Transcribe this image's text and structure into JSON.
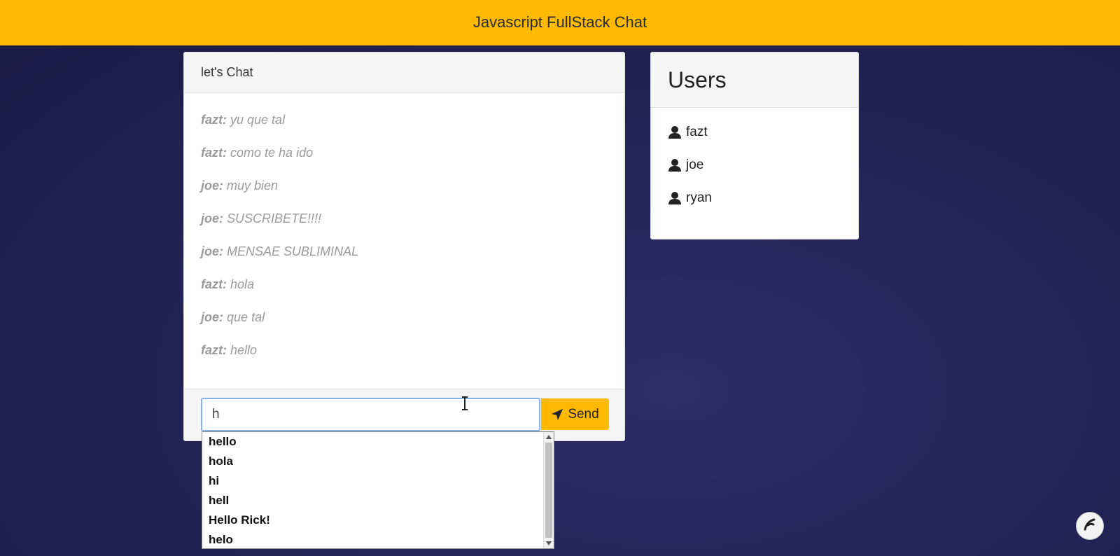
{
  "navbar": {
    "title": "Javascript FullStack Chat",
    "color": "#ffba00"
  },
  "chat": {
    "header": "let's Chat",
    "messages": [
      {
        "user": "fazt:",
        "text": "yu que tal"
      },
      {
        "user": "fazt:",
        "text": "como te ha ido"
      },
      {
        "user": "joe:",
        "text": "muy bien"
      },
      {
        "user": "joe:",
        "text": "SUSCRIBETE!!!!"
      },
      {
        "user": "joe:",
        "text": "MENSAE SUBLIMINAL"
      },
      {
        "user": "fazt:",
        "text": "hola"
      },
      {
        "user": "joe:",
        "text": "que tal"
      },
      {
        "user": "fazt:",
        "text": "hello"
      }
    ],
    "input_value": "h",
    "send_label": "Send",
    "send_icon": "paper-plane-icon"
  },
  "autocomplete": {
    "items": [
      "hello",
      "hola",
      "hi",
      "hell",
      "Hello Rick!",
      "helo"
    ]
  },
  "users": {
    "header": "Users",
    "items": [
      {
        "name": "fazt",
        "icon": "user-icon"
      },
      {
        "name": "joe",
        "icon": "user-icon"
      },
      {
        "name": "ryan",
        "icon": "user-icon"
      }
    ]
  }
}
